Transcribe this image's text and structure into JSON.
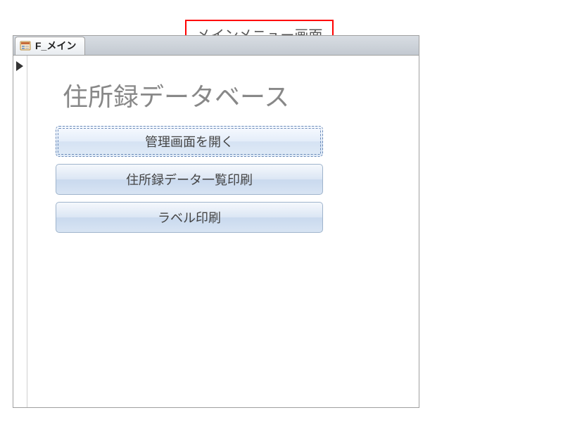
{
  "annotation": {
    "label": "メインメニュー画面"
  },
  "titlebar": {
    "tab_label": "F_メイン"
  },
  "form": {
    "title": "住所録データベース",
    "buttons": [
      {
        "label": "管理画面を開く",
        "selected": true
      },
      {
        "label": "住所録データ一覧印刷",
        "selected": false
      },
      {
        "label": "ラベル印刷",
        "selected": false
      }
    ]
  }
}
